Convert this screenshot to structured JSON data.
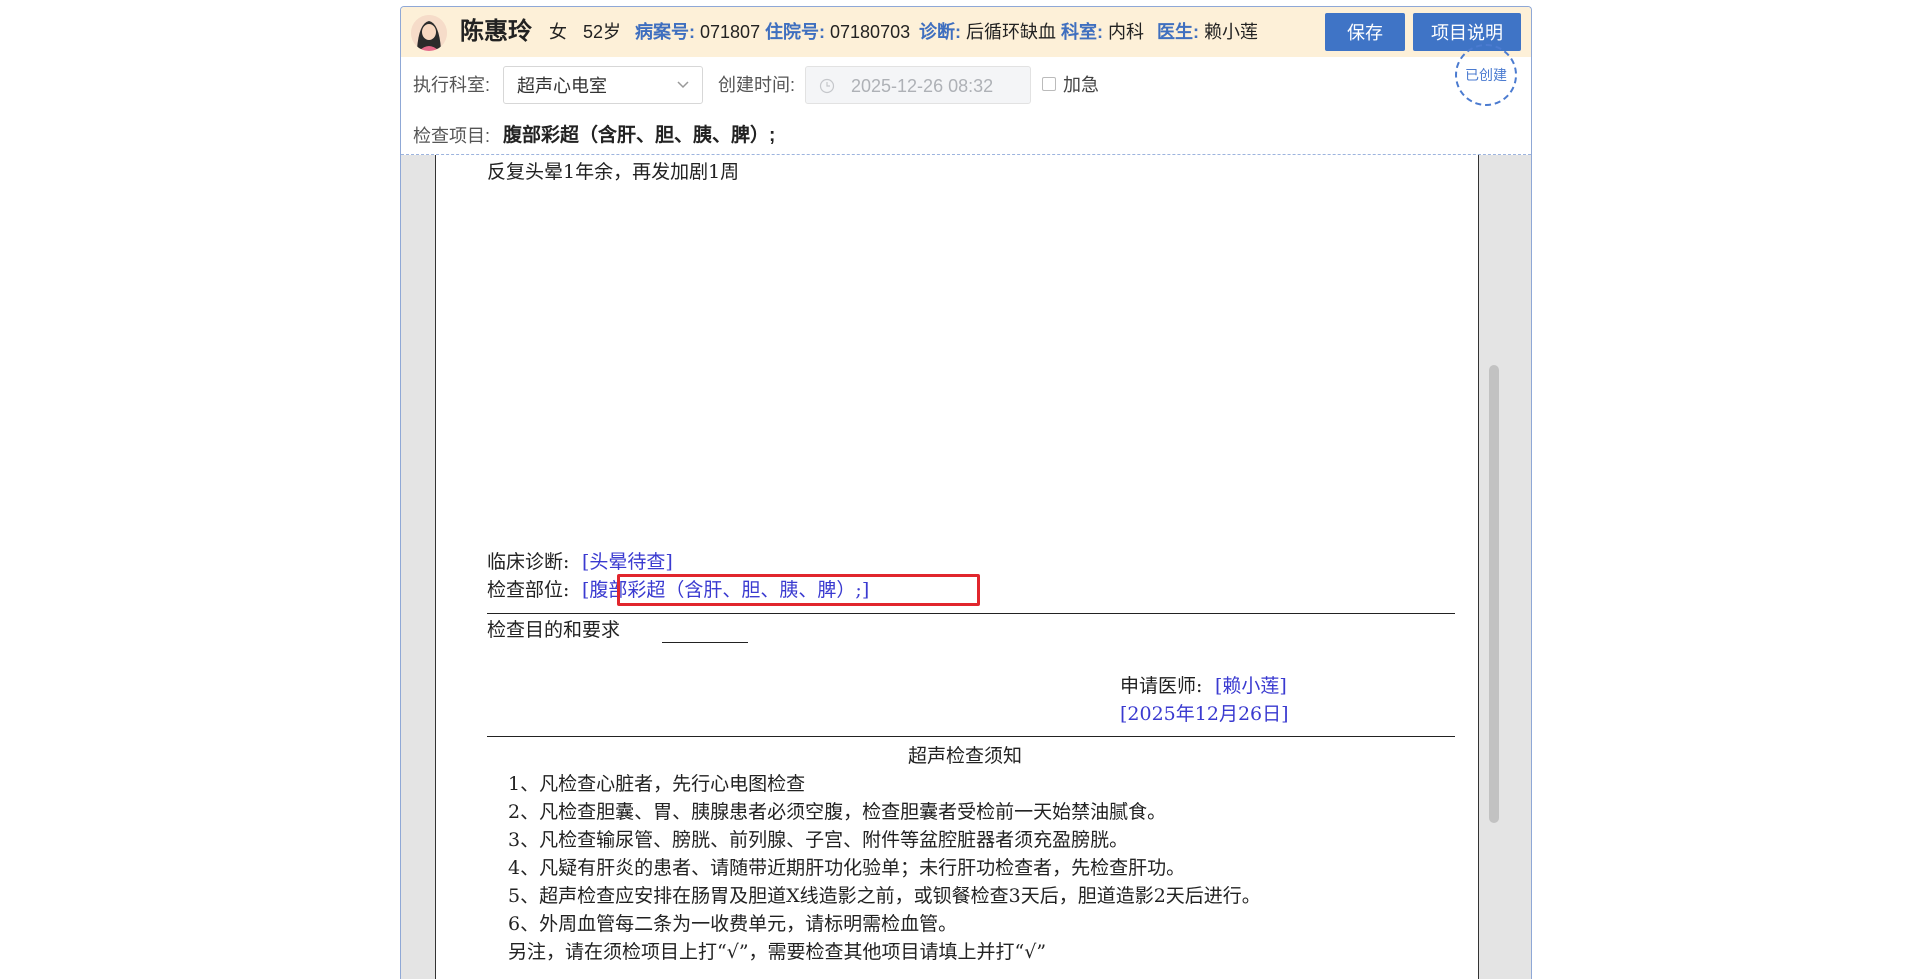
{
  "patient": {
    "name": "陈惠玲",
    "gender": "女",
    "age": "52岁",
    "record_label": "病案号:",
    "record_value": "071807",
    "inpatient_label": "住院号:",
    "inpatient_value": "07180703",
    "diagnosis_label": "诊断:",
    "diagnosis_value": "后循环缺血",
    "dept_label": "科室:",
    "dept_value": "内科",
    "doctor_label": "医生:",
    "doctor_value": "赖小莲"
  },
  "toolbar": {
    "save_label": "保存",
    "info_label": "项目说明"
  },
  "form": {
    "exec_dept_label": "执行科室:",
    "exec_dept_value": "超声心电室",
    "created_label": "创建时间:",
    "created_value": "2025-12-26 08:32",
    "urgent_label": "加急",
    "urgent_checked": false,
    "status_stamp": "已创建",
    "exam_items_label": "检查项目:",
    "exam_items_value": "腹部彩超（含肝、胆、胰、脾）;"
  },
  "document": {
    "chief_complaint": "反复头晕1年余，再发加剧1周",
    "clinical_dx_label": "临床诊断:",
    "clinical_dx_value": "[头晕待查]",
    "exam_site_label": "检查部位:",
    "exam_site_value": "[腹部彩超（含肝、胆、胰、脾）;]",
    "purpose_label": "检查目的和要求",
    "doctor_label": "申请医师:",
    "doctor_value": "[赖小莲]",
    "date_value": "[2025年12月26日]",
    "notice_title": "超声检查须知",
    "notices": [
      "1、凡检查心脏者，先行心电图检查",
      "2、凡检查胆囊、胃、胰腺患者必须空腹，检查胆囊者受检前一天始禁油腻食。",
      "3、凡检查输尿管、膀胱、前列腺、子宫、附件等盆腔脏器者须充盈膀胱。",
      "4、凡疑有肝炎的患者、请随带近期肝功化验单；未行肝功检查者，先检查肝功。",
      "5、超声检查应安排在肠胃及胆道X线造影之前，或钡餐检查3天后，胆道造影2天后进行。",
      "6、外周血管每二条为一收费单元，请标明需检血管。",
      "另注，请在须检项目上打“√”，需要检查其他项目请填上并打“√”"
    ]
  },
  "colors": {
    "banner_bg": "#fdf0d8",
    "label_blue": "#3f6fbf",
    "button_blue": "#3f74c6",
    "field_blue": "#3a3ad0",
    "highlight_red": "#e1262d"
  }
}
